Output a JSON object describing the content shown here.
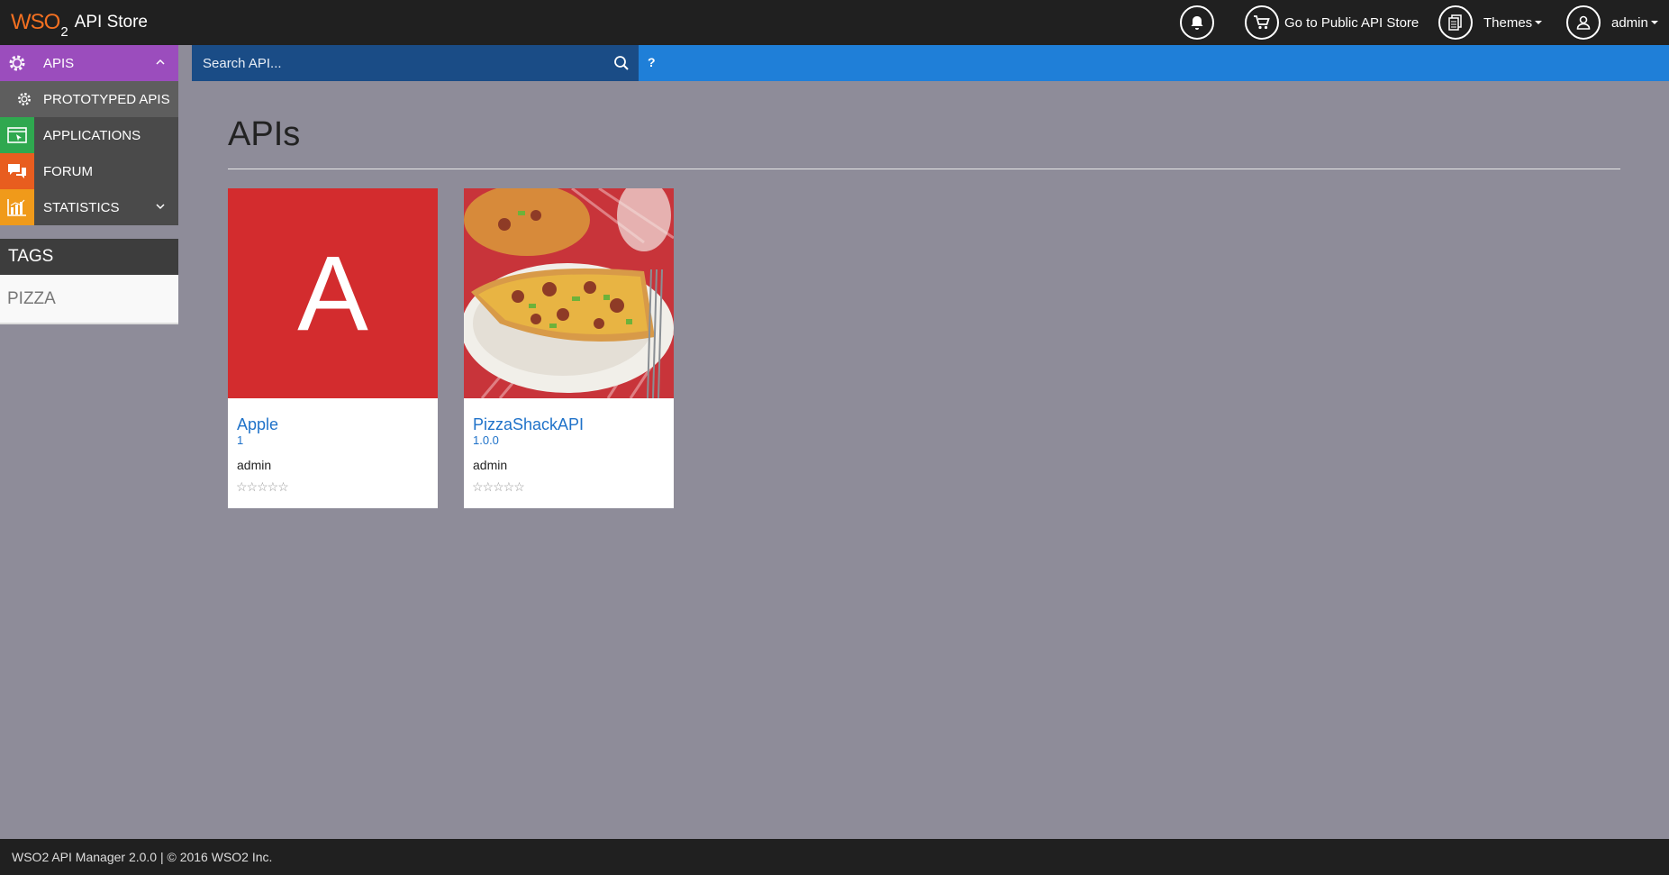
{
  "header": {
    "logo_text": "WSO",
    "logo_sub": "2",
    "app_title": "API Store",
    "public_store_label": "Go to Public API Store",
    "themes_label": "Themes",
    "user_label": "admin"
  },
  "sidebar": {
    "items": [
      {
        "label": "APIS"
      },
      {
        "label": "PROTOTYPED APIS"
      },
      {
        "label": "APPLICATIONS"
      },
      {
        "label": "FORUM"
      },
      {
        "label": "STATISTICS"
      }
    ]
  },
  "tags": {
    "heading": "TAGS",
    "items": [
      "PIZZA"
    ]
  },
  "search": {
    "placeholder": "Search API...",
    "help_label": "?"
  },
  "main": {
    "title": "APIs",
    "cards": [
      {
        "thumb_letter": "A",
        "name": "Apple",
        "version": "1",
        "owner": "admin",
        "rating": "☆☆☆☆☆"
      },
      {
        "name": "PizzaShackAPI",
        "version": "1.0.0",
        "owner": "admin",
        "rating": "☆☆☆☆☆"
      }
    ]
  },
  "footer": {
    "text": "WSO2 API Manager 2.0.0 | © 2016 WSO2 Inc."
  },
  "colors": {
    "topbar": "#202020",
    "apis_accent": "#9b4dbd",
    "applications_accent": "#2fa84f",
    "forum_accent": "#e85d1f",
    "statistics_accent": "#f09a1a",
    "search_bar": "#1f7fd8",
    "link": "#1f72c9",
    "apple_thumb": "#d32c2e"
  }
}
